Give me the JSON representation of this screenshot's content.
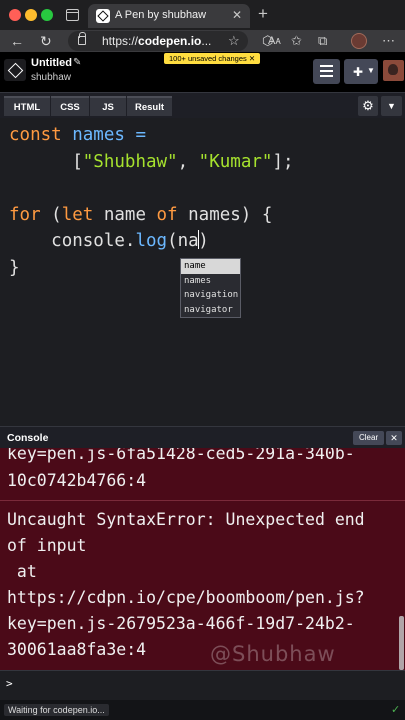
{
  "browser": {
    "tab_title": "A Pen by shubhaw",
    "tab_close": "✕",
    "new_tab": "+",
    "url_prefix": "https://",
    "url_host": "codepen.io",
    "url_suffix": "...",
    "read_aloud": "Aᴀ"
  },
  "header": {
    "pen_title": "Untitled",
    "author": "shubhaw",
    "unsaved_badge": "100+ unsaved changes  ✕"
  },
  "editor_tabs": [
    "HTML",
    "CSS",
    "JS",
    "Result"
  ],
  "code": {
    "line1_kw": "const",
    "line1_var": "names",
    "line1_eq": " =",
    "line2_open": "[",
    "line2_s1": "\"Shubhaw\"",
    "line2_comma": ", ",
    "line2_s2": "\"Kumar\"",
    "line2_close": "];",
    "line3_for": "for",
    "line3_paren": " (",
    "line3_let": "let",
    "line3_name": " name ",
    "line3_of": "of",
    "line3_rest": " names) {",
    "line4_obj": "console.",
    "line4_fn": "log",
    "line4_open": "(",
    "line4_typed": "na",
    "line4_close": ")",
    "line5": "}"
  },
  "autocomplete": [
    "name",
    "names",
    "navigation",
    "navigator"
  ],
  "console": {
    "title": "Console",
    "clear_label": "Clear",
    "close_label": "✕",
    "log_lines_top": [
      "key=pen.js-6fa51428-ced5-291a-340b-",
      "10c0742b4766:4"
    ],
    "error_lines": [
      "Uncaught SyntaxError: Unexpected end",
      "of input",
      " at",
      "https://cdpn.io/cpe/boomboom/pen.js?",
      "key=pen.js-2679523a-466f-19d7-24b2-",
      "30061aa8fa3e:4"
    ],
    "watermark": "@Shubhaw",
    "prompt": ">"
  },
  "status": {
    "text": "Waiting for codepen.io...",
    "check": "✓"
  },
  "colors": {
    "keyword": "#ff9a41",
    "variable": "#6cb8ff",
    "string": "#a6e22e",
    "console_bg": "#4b0a18",
    "unsaved_badge": "#ffdd40"
  }
}
